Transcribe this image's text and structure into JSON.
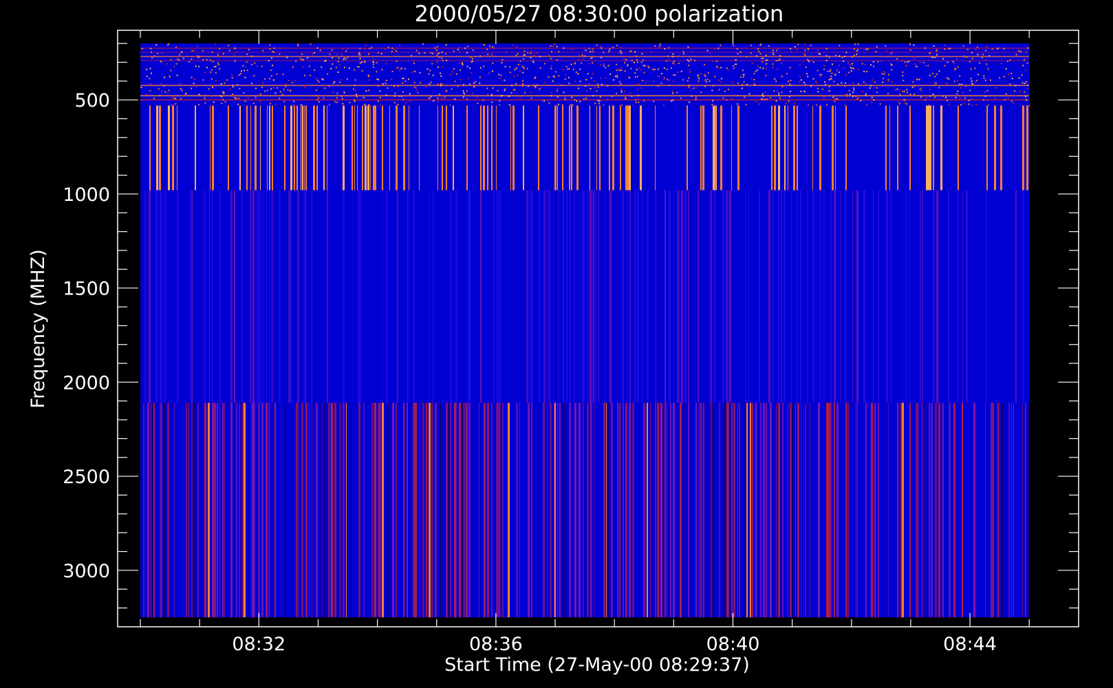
{
  "chart_data": {
    "type": "heatmap",
    "title": "2000/05/27 08:30:00 polarization",
    "xlabel": "Start Time (27-May-00 08:29:37)",
    "ylabel": "Frequency (MHZ)",
    "x_ticks": [
      "08:32",
      "08:36",
      "08:40",
      "08:44"
    ],
    "y_ticks": [
      500,
      1000,
      1500,
      2000,
      2500,
      3000
    ],
    "xlim": [
      "08:29:37",
      "08:45:50"
    ],
    "ylim": [
      3300,
      130
    ],
    "data_extent": {
      "time": [
        "08:30:00",
        "08:45:00"
      ],
      "frequency_mhz": [
        200,
        3250
      ]
    },
    "bands": [
      {
        "frequency_mhz": [
          200,
          530
        ],
        "appearance": "dense red/orange speckle on blue, horizontal striping"
      },
      {
        "frequency_mhz": [
          530,
          980
        ],
        "appearance": "blue with scattered vertical orange stripes"
      },
      {
        "frequency_mhz": [
          980,
          2110
        ],
        "appearance": "blue with faint purple vertical stripes"
      },
      {
        "frequency_mhz": [
          2110,
          3250
        ],
        "appearance": "blue with dark red/purple vertical stripes"
      }
    ],
    "colormap": [
      "#0000d2",
      "#2a10e6",
      "#7a1ab0",
      "#c0203c",
      "#ff8030",
      "#ffb060"
    ],
    "background": "#000000",
    "axis_color": "#ffffff",
    "grid": false,
    "legend": "none"
  }
}
